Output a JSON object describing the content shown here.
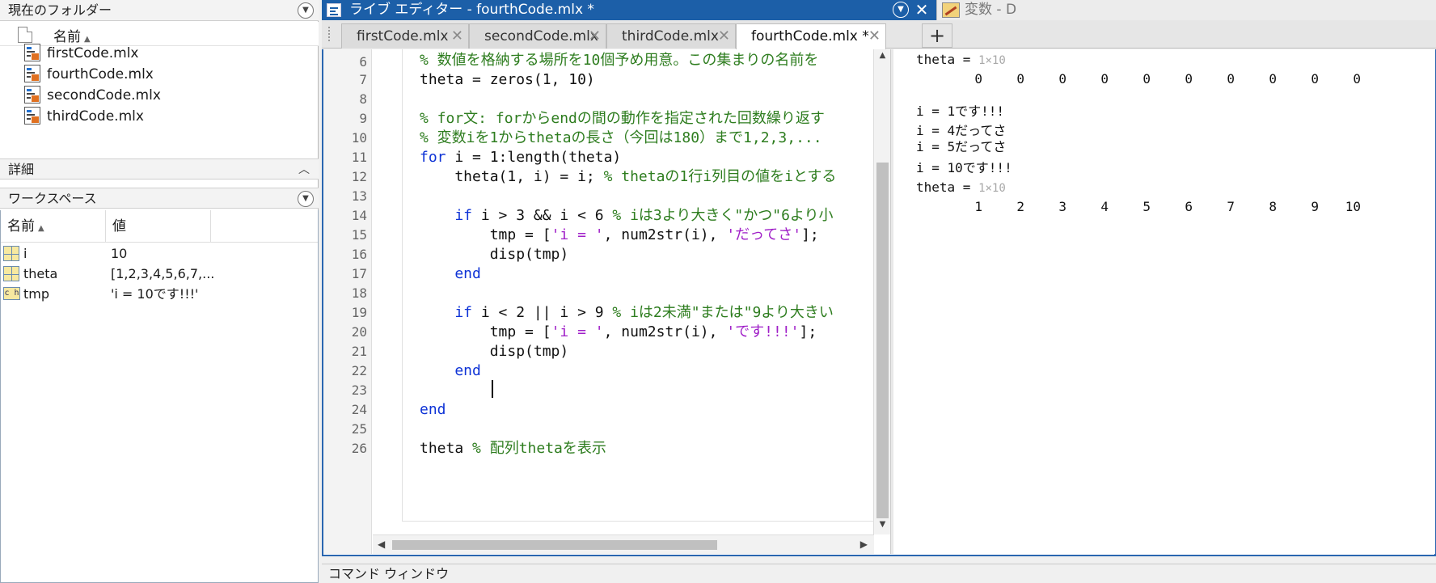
{
  "left_panel": {
    "current_folder_title": "現在のフォルダー",
    "name_column": "名前",
    "files": [
      "firstCode.mlx",
      "fourthCode.mlx",
      "secondCode.mlx",
      "thirdCode.mlx"
    ],
    "details_title": "詳細",
    "workspace_title": "ワークスペース",
    "workspace_columns": {
      "name": "名前",
      "value": "値"
    },
    "variables": [
      {
        "name": "i",
        "value": "10",
        "icon": "matrix-icon"
      },
      {
        "name": "theta",
        "value": "[1,2,3,4,5,6,7,...",
        "icon": "matrix-icon"
      },
      {
        "name": "tmp",
        "value": "'i = 10です!!!'",
        "icon": "char-icon",
        "icon_glyph": "c h"
      }
    ]
  },
  "editor": {
    "title": "ライブ エディター - fourthCode.mlx *",
    "tabs": [
      {
        "label": "firstCode.mlx",
        "active": false
      },
      {
        "label": "secondCode.mlx",
        "active": false
      },
      {
        "label": "thirdCode.mlx",
        "active": false
      },
      {
        "label": "fourthCode.mlx *",
        "active": true
      }
    ],
    "add_tab_label": "+",
    "close_glyph": "✕",
    "line_numbers": [
      "6",
      "7",
      "8",
      "9",
      "10",
      "11",
      "12",
      "13",
      "14",
      "15",
      "16",
      "17",
      "18",
      "19",
      "20",
      "21",
      "22",
      "23",
      "24",
      "25",
      "26"
    ],
    "code": {
      "l6": "% 数値を格納する場所を10個予め用意。この集まりの名前を",
      "l7": "theta = zeros(1, 10)",
      "l9": "% for文: forからendの間の動作を指定された回数繰り返す",
      "l10": "% 変数iを1からthetaの長さ（今回は180）まで1,2,3,...",
      "l11_kw": "for",
      "l11_rest": " i = 1:length(theta)",
      "l12_code": "    theta(1, i) = i; ",
      "l12_cm": "% thetaの1行i列目の値をiとする",
      "l14_kw": "    if",
      "l14_code": " i > 3 && i < 6 ",
      "l14_cm": "% iは3より大きく\"かつ\"6より小",
      "l15_a": "        tmp = [",
      "l15_s1": "'i = '",
      "l15_b": ", num2str(i), ",
      "l15_s2": "'だってさ'",
      "l15_c": "];",
      "l16": "        disp(tmp)",
      "l17": "    end",
      "l19_kw": "    if",
      "l19_code": " i < 2 || i > 9 ",
      "l19_cm": "% iは2未満\"または\"9より大きい",
      "l20_a": "        tmp = [",
      "l20_s1": "'i = '",
      "l20_b": ", num2str(i), ",
      "l20_s2": "'です!!!'",
      "l20_c": "];",
      "l21": "        disp(tmp)",
      "l22": "    end",
      "l24": "end",
      "l26_code": "theta ",
      "l26_cm": "% 配列thetaを表示"
    }
  },
  "output": {
    "theta_label_1": "theta = ",
    "theta_dim_1": "1×10",
    "zeros": [
      "0",
      "0",
      "0",
      "0",
      "0",
      "0",
      "0",
      "0",
      "0",
      "0"
    ],
    "lines": [
      "i = 1です!!!",
      "i = 4だってさ",
      "i = 5だってさ",
      "i = 10です!!!"
    ],
    "theta_label_2": "theta = ",
    "theta_dim_2": "1×10",
    "values": [
      "1",
      "2",
      "3",
      "4",
      "5",
      "6",
      "7",
      "8",
      "9",
      "10"
    ]
  },
  "variables_window": {
    "title": "変数 - D"
  },
  "command_window": {
    "title": "コマンド ウィンドウ"
  },
  "colors": {
    "title_bar": "#1c5fa8",
    "keyword": "#0e33d6",
    "comment": "#2e7d1f",
    "string": "#a020c8"
  }
}
